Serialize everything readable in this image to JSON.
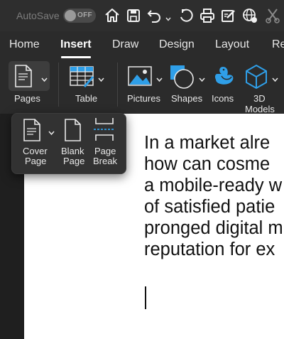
{
  "titlebar": {
    "autosave_label": "AutoSave",
    "toggle_state": "OFF",
    "icons": [
      "home-icon",
      "save-icon",
      "undo-icon",
      "redo-icon",
      "print-icon",
      "edit-icon",
      "globe-icon",
      "cut-icon"
    ]
  },
  "tabs": [
    {
      "label": "Home"
    },
    {
      "label": "Insert",
      "active": true
    },
    {
      "label": "Draw"
    },
    {
      "label": "Design"
    },
    {
      "label": "Layout"
    },
    {
      "label": "Re"
    }
  ],
  "ribbon": {
    "pages_label": "Pages",
    "table_label": "Table",
    "pictures_label": "Pictures",
    "shapes_label": "Shapes",
    "icons_label": "Icons",
    "models_label_1": "3D",
    "models_label_2": "Models"
  },
  "popover": {
    "cover_1": "Cover",
    "cover_2": "Page",
    "blank_1": "Blank",
    "blank_2": "Page",
    "break_1": "Page",
    "break_2": "Break"
  },
  "document": {
    "lines": [
      "In a market alre",
      "how can cosme",
      "a mobile-ready w",
      "of satisfied patie",
      "pronged digital m",
      "reputation for ex"
    ]
  },
  "colors": {
    "accent_blue": "#2f9fe8",
    "selected_tab": "#ffffff",
    "page": "#ffffff"
  }
}
